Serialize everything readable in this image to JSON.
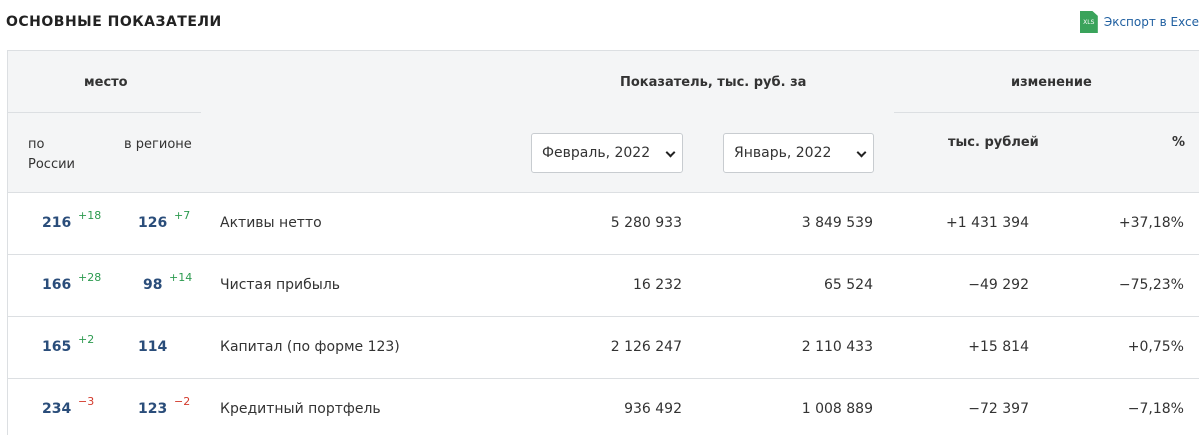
{
  "header": {
    "title": "ОСНОВНЫЕ ПОКАЗАТЕЛИ",
    "export_label": "Экспорт в Exce",
    "export_icon_text": "XLS"
  },
  "table": {
    "group_place": "место",
    "group_indicator": "Показатель, тыс. руб. за",
    "group_change": "изменение",
    "col_russia": "по России",
    "col_region": "в регионе",
    "col_thousand": "тыс. рублей",
    "col_percent": "%",
    "period1": "Февраль, 2022",
    "period2": "Январь, 2022",
    "rows": [
      {
        "rank_russia": "216",
        "rank_russia_delta": "+18",
        "rank_region": "126",
        "rank_region_delta": "+7",
        "name": "Активы нетто",
        "value1": "5 280 933",
        "value2": "3 849 539",
        "change_abs": "+1 431 394",
        "change_pct": "+37,18%"
      },
      {
        "rank_russia": "166",
        "rank_russia_delta": "+28",
        "rank_region": "98",
        "rank_region_delta": "+14",
        "name": "Чистая прибыль",
        "value1": "16 232",
        "value2": "65 524",
        "change_abs": "−49 292",
        "change_pct": "−75,23%"
      },
      {
        "rank_russia": "165",
        "rank_russia_delta": "+2",
        "rank_region": "114",
        "rank_region_delta": "",
        "name": "Капитал (по форме 123)",
        "value1": "2 126 247",
        "value2": "2 110 433",
        "change_abs": "+15 814",
        "change_pct": "+0,75%"
      },
      {
        "rank_russia": "234",
        "rank_russia_delta": "−3",
        "rank_region": "123",
        "rank_region_delta": "−2",
        "name": "Кредитный портфель",
        "value1": "936 492",
        "value2": "1 008 889",
        "change_abs": "−72 397",
        "change_pct": "−7,18%"
      }
    ]
  },
  "colors": {
    "positive": "#2c9a4f",
    "negative": "#d33a2c",
    "rank": "#2a4d7a"
  }
}
